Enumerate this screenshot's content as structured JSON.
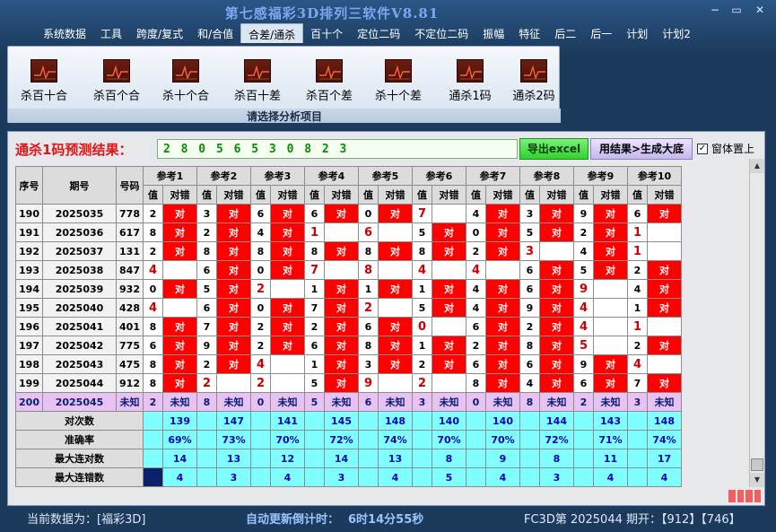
{
  "app": {
    "title": "第七感福彩3D排列三软件V8.81"
  },
  "window": {
    "minimize": "−",
    "maximize": "▭",
    "close": "✕"
  },
  "menu": [
    {
      "label": "系统数据",
      "active": false
    },
    {
      "label": "工具",
      "active": false
    },
    {
      "label": "跨度/复式",
      "active": false
    },
    {
      "label": "和/合值",
      "active": false
    },
    {
      "label": "合差/通杀",
      "active": true
    },
    {
      "label": "百十个",
      "active": false
    },
    {
      "label": "定位二码",
      "active": false
    },
    {
      "label": "不定位二码",
      "active": false
    },
    {
      "label": "振幅",
      "active": false
    },
    {
      "label": "特征",
      "active": false
    },
    {
      "label": "后二",
      "active": false
    },
    {
      "label": "后一",
      "active": false
    },
    {
      "label": "计划",
      "active": false
    },
    {
      "label": "计划2",
      "active": false
    }
  ],
  "ribbon": {
    "buttons": [
      "杀百十合",
      "杀百个合",
      "杀十个合",
      "杀百十差",
      "杀百个差",
      "杀十个差",
      "通杀1码",
      "通杀2码"
    ],
    "icon": "chart-icon",
    "caption": "请选择分析项目"
  },
  "prediction": {
    "label": "通杀1码预测结果：",
    "value": "2 8 0 5 6 5 3 0 8 2 3"
  },
  "buttons": {
    "export": "导出excel",
    "generate": "用结果>生成大底",
    "topmost": "窗体置上"
  },
  "table": {
    "headers": {
      "index": "序号",
      "period": "期号",
      "number": "号码",
      "ref_groups": [
        "参考1",
        "参考2",
        "参考3",
        "参考4",
        "参考5",
        "参考6",
        "参考7",
        "参考8",
        "参考9",
        "参考10"
      ],
      "value": "值",
      "result": "对错"
    },
    "rows": [
      {
        "idx": "190",
        "period": "2025035",
        "num": "778",
        "refs": [
          [
            "2",
            "对"
          ],
          [
            "3",
            "对"
          ],
          [
            "6",
            "对"
          ],
          [
            "6",
            "对"
          ],
          [
            "0",
            "对"
          ],
          [
            "7",
            ""
          ],
          [
            "4",
            "对"
          ],
          [
            "3",
            "对"
          ],
          [
            "9",
            "对"
          ],
          [
            "6",
            "对"
          ]
        ]
      },
      {
        "idx": "191",
        "period": "2025036",
        "num": "617",
        "refs": [
          [
            "8",
            "对"
          ],
          [
            "2",
            "对"
          ],
          [
            "4",
            "对"
          ],
          [
            "1",
            ""
          ],
          [
            "6",
            ""
          ],
          [
            "5",
            "对"
          ],
          [
            "0",
            "对"
          ],
          [
            "5",
            "对"
          ],
          [
            "2",
            "对"
          ],
          [
            "1",
            ""
          ]
        ]
      },
      {
        "idx": "192",
        "period": "2025037",
        "num": "131",
        "refs": [
          [
            "2",
            "对"
          ],
          [
            "8",
            "对"
          ],
          [
            "8",
            "对"
          ],
          [
            "8",
            "对"
          ],
          [
            "8",
            "对"
          ],
          [
            "8",
            "对"
          ],
          [
            "2",
            "对"
          ],
          [
            "3",
            ""
          ],
          [
            "4",
            "对"
          ],
          [
            "1",
            ""
          ]
        ]
      },
      {
        "idx": "193",
        "period": "2025038",
        "num": "847",
        "refs": [
          [
            "4",
            ""
          ],
          [
            "6",
            "对"
          ],
          [
            "0",
            "对"
          ],
          [
            "7",
            ""
          ],
          [
            "8",
            ""
          ],
          [
            "4",
            ""
          ],
          [
            "4",
            ""
          ],
          [
            "6",
            "对"
          ],
          [
            "5",
            "对"
          ],
          [
            "2",
            "对"
          ]
        ]
      },
      {
        "idx": "194",
        "period": "2025039",
        "num": "932",
        "refs": [
          [
            "0",
            "对"
          ],
          [
            "5",
            "对"
          ],
          [
            "2",
            ""
          ],
          [
            "1",
            "对"
          ],
          [
            "1",
            "对"
          ],
          [
            "1",
            "对"
          ],
          [
            "4",
            "对"
          ],
          [
            "6",
            "对"
          ],
          [
            "9",
            ""
          ],
          [
            "4",
            "对"
          ]
        ]
      },
      {
        "idx": "195",
        "period": "2025040",
        "num": "428",
        "refs": [
          [
            "4",
            ""
          ],
          [
            "6",
            "对"
          ],
          [
            "0",
            "对"
          ],
          [
            "7",
            "对"
          ],
          [
            "2",
            ""
          ],
          [
            "5",
            "对"
          ],
          [
            "4",
            "对"
          ],
          [
            "9",
            "对"
          ],
          [
            "4",
            ""
          ],
          [
            "1",
            "对"
          ]
        ]
      },
      {
        "idx": "196",
        "period": "2025041",
        "num": "401",
        "refs": [
          [
            "8",
            "对"
          ],
          [
            "7",
            "对"
          ],
          [
            "2",
            "对"
          ],
          [
            "2",
            "对"
          ],
          [
            "6",
            "对"
          ],
          [
            "0",
            ""
          ],
          [
            "6",
            "对"
          ],
          [
            "2",
            "对"
          ],
          [
            "4",
            ""
          ],
          [
            "1",
            ""
          ]
        ]
      },
      {
        "idx": "197",
        "period": "2025042",
        "num": "775",
        "refs": [
          [
            "6",
            "对"
          ],
          [
            "9",
            "对"
          ],
          [
            "2",
            "对"
          ],
          [
            "6",
            "对"
          ],
          [
            "8",
            "对"
          ],
          [
            "1",
            "对"
          ],
          [
            "2",
            "对"
          ],
          [
            "8",
            "对"
          ],
          [
            "5",
            ""
          ],
          [
            "2",
            "对"
          ]
        ]
      },
      {
        "idx": "198",
        "period": "2025043",
        "num": "475",
        "refs": [
          [
            "8",
            "对"
          ],
          [
            "2",
            "对"
          ],
          [
            "4",
            ""
          ],
          [
            "1",
            "对"
          ],
          [
            "3",
            "对"
          ],
          [
            "2",
            "对"
          ],
          [
            "6",
            "对"
          ],
          [
            "6",
            "对"
          ],
          [
            "9",
            "对"
          ],
          [
            "4",
            ""
          ]
        ]
      },
      {
        "idx": "199",
        "period": "2025044",
        "num": "912",
        "refs": [
          [
            "8",
            "对"
          ],
          [
            "2",
            ""
          ],
          [
            "2",
            ""
          ],
          [
            "5",
            "对"
          ],
          [
            "9",
            ""
          ],
          [
            "2",
            ""
          ],
          [
            "8",
            "对"
          ],
          [
            "4",
            "对"
          ],
          [
            "6",
            "对"
          ],
          [
            "7",
            "对"
          ]
        ]
      }
    ],
    "pending": {
      "idx": "200",
      "period": "2025045",
      "num": "未知",
      "refs": [
        [
          "2",
          "未知"
        ],
        [
          "8",
          "未知"
        ],
        [
          "0",
          "未知"
        ],
        [
          "5",
          "未知"
        ],
        [
          "6",
          "未知"
        ],
        [
          "3",
          "未知"
        ],
        [
          "0",
          "未知"
        ],
        [
          "8",
          "未知"
        ],
        [
          "2",
          "未知"
        ],
        [
          "3",
          "未知"
        ]
      ]
    },
    "stats": [
      {
        "label": "对次数",
        "values": [
          "139",
          "147",
          "141",
          "145",
          "148",
          "140",
          "140",
          "144",
          "143",
          "148"
        ]
      },
      {
        "label": "准确率",
        "values": [
          "69%",
          "73%",
          "70%",
          "72%",
          "74%",
          "70%",
          "70%",
          "72%",
          "71%",
          "74%"
        ]
      },
      {
        "label": "最大连对数",
        "values": [
          "14",
          "13",
          "12",
          "14",
          "13",
          "8",
          "9",
          "8",
          "11",
          "17"
        ]
      },
      {
        "label": "最大连错数",
        "values": [
          "4",
          "3",
          "4",
          "3",
          "4",
          "5",
          "4",
          "3",
          "4",
          "4"
        ]
      }
    ]
  },
  "status": {
    "current_label": "当前数据为：[福彩3D]",
    "countdown_label": "自动更新倒计时：",
    "countdown": "6时14分55秒",
    "issue": "FC3D第 2025044 期开：【912】【746】"
  }
}
